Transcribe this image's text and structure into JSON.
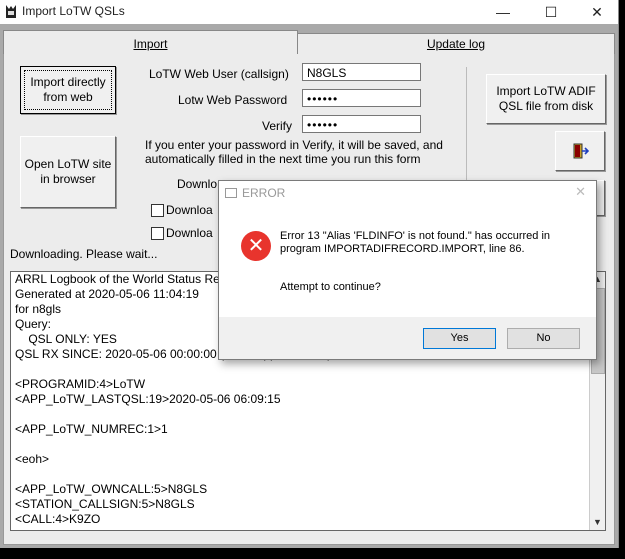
{
  "window": {
    "title": "Import LoTW QSLs",
    "minimize": "—",
    "maximize": "☐",
    "close": "✕"
  },
  "tabs": [
    "Import",
    "Update log"
  ],
  "buttons": {
    "import_web": "Import directly from web",
    "open_site": "Open LoTW site in browser",
    "import_adif": "Import LoTW ADIF QSL file from disk"
  },
  "form": {
    "user_label": "LoTW Web User (callsign)",
    "user_value": "N8GLS",
    "password_label": "Lotw Web Password",
    "password_value": "••••••",
    "verify_label": "Verify",
    "verify_value": "••••••",
    "note": "If you enter your password in Verify, it will be saved, and automatically filled in the next time you run this form",
    "download_label": "Downlo",
    "chk1_label": "Downloa",
    "chk2_label": "Downloa"
  },
  "status": "Downloading.  Please wait...",
  "log_lines": [
    "ARRL Logbook of the World Status Re",
    "Generated at 2020-05-06 11:04:19",
    "for n8gls",
    "Query:",
    "    QSL ONLY: YES",
    "QSL RX SINCE: 2020-05-06 00:00:00 (user supplied value)",
    "",
    "<PROGRAMID:4>LoTW",
    "<APP_LoTW_LASTQSL:19>2020-05-06 06:09:15",
    "",
    "<APP_LoTW_NUMREC:1>1",
    "",
    "<eoh>",
    "",
    "<APP_LoTW_OWNCALL:5>N8GLS",
    "<STATION_CALLSIGN:5>N8GLS",
    "<CALL:4>K9ZO"
  ],
  "dialog": {
    "title": "ERROR",
    "message": "Error 13 \"Alias 'FLDINFO' is not found.\" has occurred in program IMPORTADIFRECORD.IMPORT, line 86.",
    "question": "Attempt to continue?",
    "yes": "Yes",
    "no": "No"
  },
  "colors": {
    "error_red": "#e8342d",
    "focus_blue": "#0078d7"
  }
}
